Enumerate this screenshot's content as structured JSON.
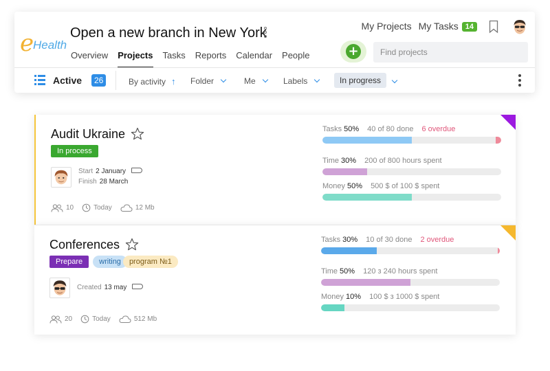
{
  "logo": {
    "letter": "e",
    "word": "Health"
  },
  "header": {
    "title": "Open a new branch in New York",
    "tabs": [
      {
        "label": "Overview"
      },
      {
        "label": "Projects"
      },
      {
        "label": "Tasks"
      },
      {
        "label": "Reports"
      },
      {
        "label": "Calendar"
      },
      {
        "label": "People"
      }
    ],
    "active_tab": "Projects",
    "my_projects": "My Projects",
    "my_tasks": "My Tasks",
    "my_tasks_count": "14",
    "add_symbol": "+",
    "search_placeholder": "Find projects"
  },
  "toolbar": {
    "status_label": "Active",
    "status_count": "26",
    "sort_label": "By activity",
    "sort_icon": "↑",
    "folder_label": "Folder",
    "owner_label": "Me",
    "labels_label": "Labels",
    "state_filter": "In progress"
  },
  "projects": [
    {
      "title": "Audit Ukraine",
      "tags": [
        "In process"
      ],
      "start_label": "Start",
      "start_value": "2 January",
      "finish_label": "Finish",
      "finish_value": "28 March",
      "members": "10",
      "activity": "Today",
      "size": "12 Mb",
      "corner_color": "#9c19e0",
      "tasks": {
        "label": "Tasks",
        "percent": "50%",
        "detail": "40 of 80 done",
        "overdue": "6 overdue",
        "fill": 0.5,
        "overdue_fill": 0.03
      },
      "time": {
        "label": "Time",
        "percent": "30%",
        "detail": "200 of 800 hours spent",
        "fill": 0.25
      },
      "money": {
        "label": "Money",
        "percent": "50%",
        "detail": "500 $ of 100 $ spent",
        "fill": 0.5
      }
    },
    {
      "title": "Conferences",
      "tags": [
        "Prepare",
        "writing",
        "program №1"
      ],
      "created_label": "Created",
      "created_value": "13 may",
      "members": "20",
      "activity": "Today",
      "size": "512 Mb",
      "corner_color": "#f5b82e",
      "tasks": {
        "label": "Tasks",
        "percent": "30%",
        "detail": "10 of 30  done",
        "overdue": "2 overdue",
        "fill": 0.31,
        "overdue_fill": 0.01
      },
      "time": {
        "label": "Time",
        "percent": "50%",
        "detail": "120 з 240 hours spent",
        "fill": 0.5
      },
      "money": {
        "label": "Money",
        "percent": "10%",
        "detail": "100 $ з 1000 $ spent",
        "fill": 0.13
      }
    }
  ],
  "colors": {
    "tasks_bar": "#8ec9f5",
    "tasks_bar_2": "#5aa9ea",
    "overdue_bar": "#ef8a9a",
    "time_bar": "#cfa2d6",
    "money_bar": "#7fdcc9",
    "money_bar_2": "#66d6c2"
  }
}
